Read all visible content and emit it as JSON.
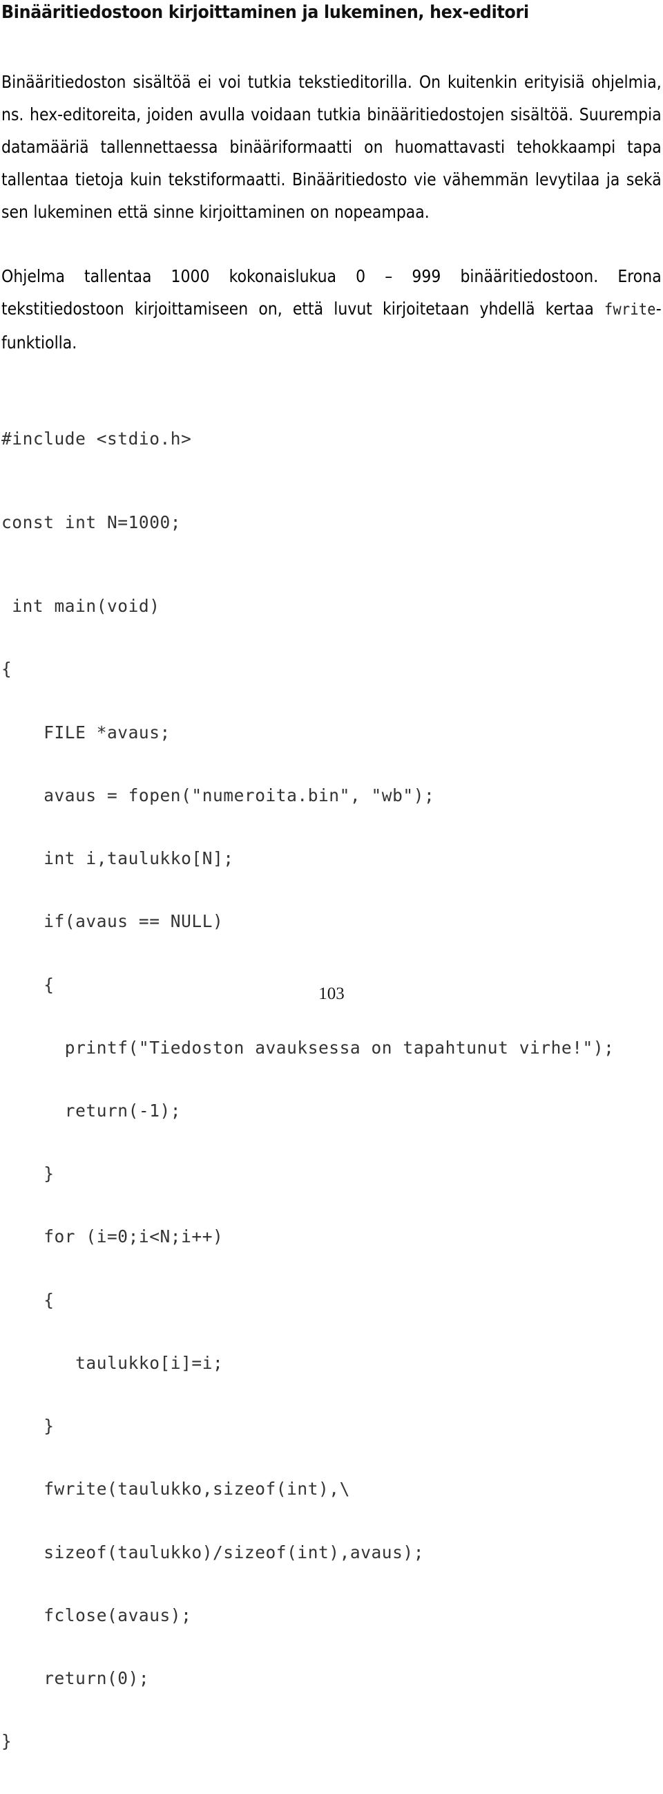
{
  "document": {
    "title": "Binääritiedostoon kirjoittaminen ja lukeminen, hex-editori",
    "page_number": "103"
  },
  "paragraphs": {
    "p1": "Binääritiedoston sisältöä ei voi tutkia tekstieditorilla. On kuitenkin erityisiä ohjelmia, ns. hex-editoreita, joiden avulla voidaan tutkia binääritiedostojen sisältöä. Suurempia datamääriä tallennettaessa binääriformaatti on huomattavasti tehokkaampi tapa tallentaa tietoja kuin tekstiformaatti. Binääritiedosto vie vähemmän levytilaa ja sekä sen lukeminen että sinne kirjoittaminen on nopeampaa.",
    "p2_before_code_ref": "Ohjelma tallentaa 1000 kokonaislukua 0 – 999 binääritiedostoon. Erona tekstitiedostoon kirjoittamiseen on, että luvut kirjoitetaan yhdellä kertaa ",
    "p2_code_ref": "fwrite",
    "p2_after_code_ref": "-funktiolla."
  },
  "code": {
    "language": "C",
    "lines": [
      "#include <stdio.h>",
      "const int N=1000;",
      " int main(void)",
      "{",
      "    FILE *avaus;",
      "    avaus = fopen(\"numeroita.bin\", \"wb\");",
      "    int i,taulukko[N];",
      "    if(avaus == NULL)",
      "    {",
      "      printf(\"Tiedoston avauksessa on tapahtunut virhe!\");",
      "      return(-1);",
      "    }",
      "    for (i=0;i<N;i++)",
      "    {",
      "       taulukko[i]=i;",
      "    }",
      "    fwrite(taulukko,sizeof(int),\\",
      "    sizeof(taulukko)/sizeof(int),avaus);",
      "    fclose(avaus);",
      "    return(0);",
      "}"
    ]
  }
}
